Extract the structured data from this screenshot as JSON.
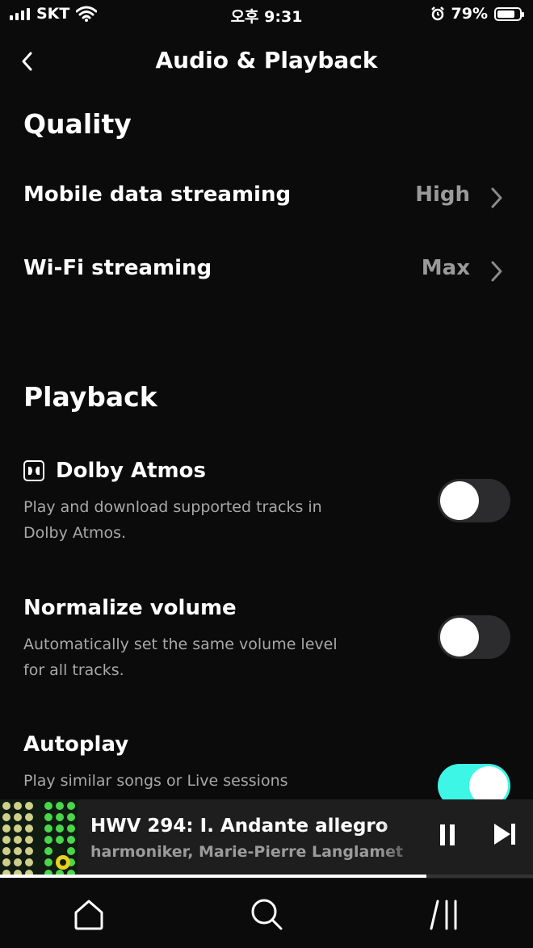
{
  "status_bar": {
    "carrier": "SKT",
    "time": "오후 9:31",
    "battery": "79%",
    "battery_level": 0.79
  },
  "header": {
    "title": "Audio & Playback"
  },
  "quality": {
    "title": "Quality",
    "rows": [
      {
        "label": "Mobile data streaming",
        "value": "High"
      },
      {
        "label": "Wi-Fi streaming",
        "value": "Max"
      }
    ]
  },
  "playback": {
    "title": "Playback",
    "items": [
      {
        "label": "Dolby Atmos",
        "description": "Play and download supported tracks in Dolby Atmos.",
        "enabled": false
      },
      {
        "label": "Normalize volume",
        "description": "Automatically set the same volume level for all tracks.",
        "enabled": false
      },
      {
        "label": "Autoplay",
        "description": "Play similar songs or Live sessions",
        "enabled": true
      }
    ]
  },
  "player": {
    "track": "HWV 294: I. Andante allegro",
    "artist": "harmoniker, Marie-Pierre Langlamet",
    "progress": 0.8
  },
  "tabs": [
    "home-icon",
    "search-icon",
    "library-icon"
  ],
  "colors": {
    "accent": "#3ef6e6",
    "background": "#0b0b0b",
    "secondary_text": "#a8a8a8"
  }
}
